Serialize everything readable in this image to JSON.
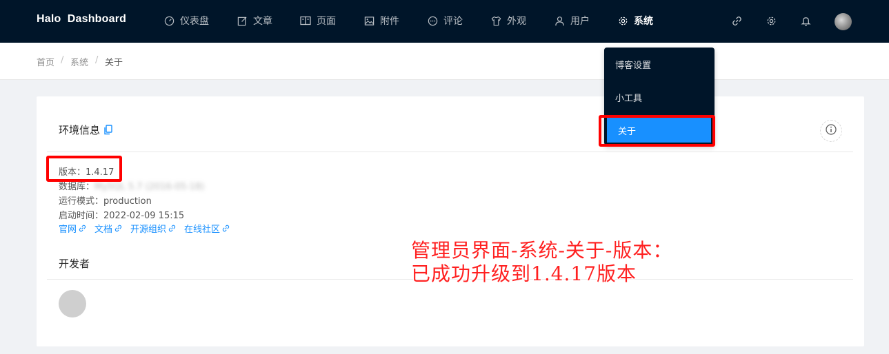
{
  "app": {
    "brand": "Halo  Dashboard"
  },
  "nav": {
    "items": [
      {
        "label": "仪表盘",
        "icon": "dashboard-icon"
      },
      {
        "label": "文章",
        "icon": "edit-icon"
      },
      {
        "label": "页面",
        "icon": "read-icon"
      },
      {
        "label": "附件",
        "icon": "picture-icon"
      },
      {
        "label": "评论",
        "icon": "message-icon"
      },
      {
        "label": "外观",
        "icon": "skin-icon"
      },
      {
        "label": "用户",
        "icon": "user-icon"
      },
      {
        "label": "系统",
        "icon": "setting-icon",
        "active": true
      }
    ],
    "right_icons": [
      "link-icon",
      "gear-icon",
      "bell-icon",
      "avatar"
    ]
  },
  "breadcrumb": {
    "items": [
      "首页",
      "系统",
      "关于"
    ],
    "separator": "/"
  },
  "dropdown": {
    "items": [
      {
        "label": "博客设置"
      },
      {
        "label": "小工具"
      },
      {
        "label": "关于",
        "selected": true
      }
    ]
  },
  "env_card": {
    "title": "环境信息",
    "version": "版本：1.4.17",
    "database_label": "数据库：",
    "database_value": "MySQL 5.7 (2016-05-18)",
    "mode": "运行模式：production",
    "start_time": "启动时间：2022-02-09 15:15",
    "links": [
      "官网",
      "文档",
      "开源组织",
      "在线社区"
    ]
  },
  "developers": {
    "title": "开发者"
  },
  "annotation": {
    "line1": "管理员界面-系统-关于-版本：",
    "line2": "已成功升级到1.4.17版本"
  },
  "colors": {
    "nav_bg": "#001529",
    "accent": "#1890ff",
    "highlight": "#ff0000"
  }
}
